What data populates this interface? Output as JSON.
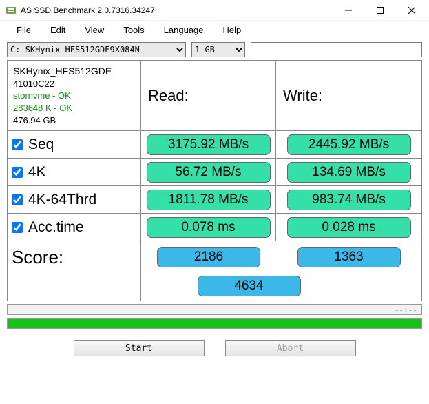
{
  "window": {
    "title": "AS SSD Benchmark 2.0.7316.34247"
  },
  "menu": {
    "file": "File",
    "edit": "Edit",
    "view": "View",
    "tools": "Tools",
    "language": "Language",
    "help": "Help"
  },
  "toolbar": {
    "drive": "C: SKHynix_HFS512GDE9X084N",
    "size": "1 GB",
    "extra": ""
  },
  "info": {
    "drive_name": "SKHynix_HFS512GDE",
    "firmware": "41010C22",
    "driver": "stornvme - OK",
    "alignment": "283648 K - OK",
    "capacity": "476.94 GB"
  },
  "headers": {
    "read": "Read:",
    "write": "Write:"
  },
  "tests": {
    "seq": {
      "label": "Seq",
      "read": "3175.92 MB/s",
      "write": "2445.92 MB/s"
    },
    "fourk": {
      "label": "4K",
      "read": "56.72 MB/s",
      "write": "134.69 MB/s"
    },
    "fourk64": {
      "label": "4K-64Thrd",
      "read": "1811.78 MB/s",
      "write": "983.74 MB/s"
    },
    "acc": {
      "label": "Acc.time",
      "read": "0.078 ms",
      "write": "0.028 ms"
    }
  },
  "score": {
    "label": "Score:",
    "read": "2186",
    "write": "1363",
    "total": "4634"
  },
  "progress": {
    "text": "--:--"
  },
  "buttons": {
    "start": "Start",
    "abort": "Abort"
  }
}
